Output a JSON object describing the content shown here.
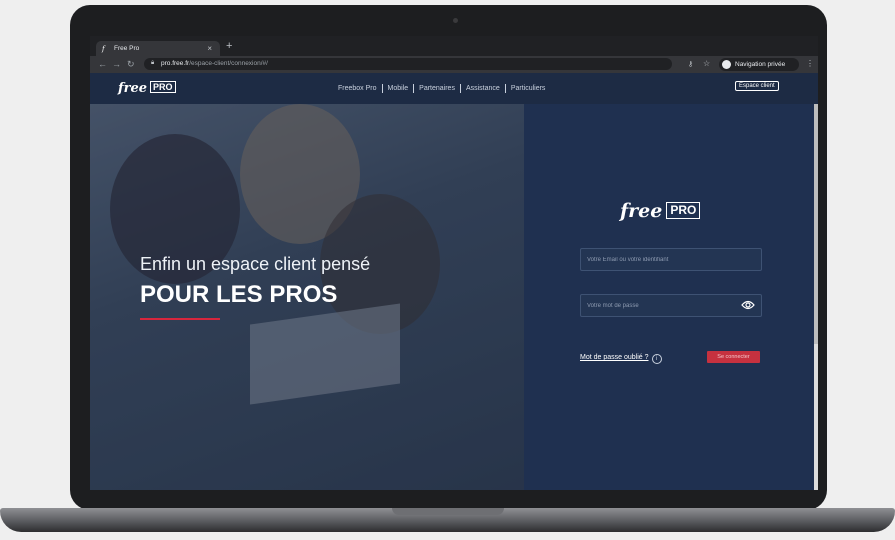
{
  "browser": {
    "tab_title": "Free Pro",
    "tab_favicon": "f",
    "tab_close": "×",
    "new_tab": "+",
    "url_host": "pro.free.fr",
    "url_path": "/espace-client/connexion/#/",
    "profile_label": "Navigation privée",
    "icons": [
      "back-icon",
      "forward-icon",
      "reload-icon",
      "lock-icon",
      "key-icon",
      "star-icon",
      "incognito-icon",
      "menu-icon"
    ]
  },
  "site": {
    "logo_text": "free",
    "logo_badge": "PRO",
    "nav": [
      "Freebox Pro",
      "Mobile",
      "Partenaires",
      "Assistance",
      "Particuliers"
    ],
    "account_button": "Espace client"
  },
  "hero": {
    "line1": "Enfin un espace client pensé",
    "line2": "POUR LES PROS",
    "accent_color": "#d7263d"
  },
  "login": {
    "logo_text": "free",
    "logo_badge": "PRO",
    "email_placeholder": "Votre Email ou votre identifiant",
    "password_placeholder": "Votre mot de passe",
    "forgot_label": "Mot de passe oublié ?",
    "info_glyph": "i",
    "submit_label": "Se connecter",
    "panel_color": "#1f3050",
    "button_color": "#c6313f"
  }
}
